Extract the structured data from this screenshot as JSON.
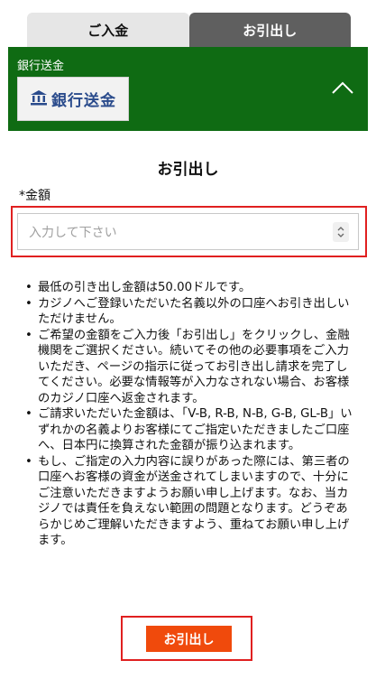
{
  "tabs": {
    "deposit": "ご入金",
    "withdraw": "お引出し"
  },
  "bank_panel": {
    "label": "銀行送金",
    "card_text": "銀行送金",
    "card_icon": "bank-icon",
    "toggle_icon": "chevron-up-icon"
  },
  "withdraw_form": {
    "title": "お引出し",
    "amount_label": "*金額",
    "amount_placeholder": "入力して下さい"
  },
  "notes": [
    "最低の引き出し金額は50.00ドルです。",
    "カジノへご登録いただいた名義以外の口座へお引き出しいただけません。",
    "ご希望の金額をご入力後「お引出し」をクリックし、金融機関をご選択ください。続いてその他の必要事項をご入力いただき、ページの指示に従ってお引き出し請求を完了してください。必要な情報等が入力なされない場合、お客様のカジノ口座へ返金されます。",
    "ご請求いただいた金額は、「V-B, R-B, N-B, G-B, GL-B」いずれかの名義よりお客様にてご指定いただきましたご口座へ、日本円に換算された金額が振り込まれます。",
    "もし、ご指定の入力内容に誤りがあった際には、第三者の口座へお客様の資金が送金されてしまいますので、十分にご注意いただきますようお願い申し上げます。なお、当カジノでは責任を負えない範囲の問題となります。どうぞあらかじめご理解いただきますよう、重ねてお願い申し上げます。"
  ],
  "submit_label": "お引出し",
  "colors": {
    "panel_green": "#0f6b13",
    "active_tab": "#5f5f5f",
    "button_orange": "#f04a0c",
    "highlight_red": "#e02020"
  }
}
